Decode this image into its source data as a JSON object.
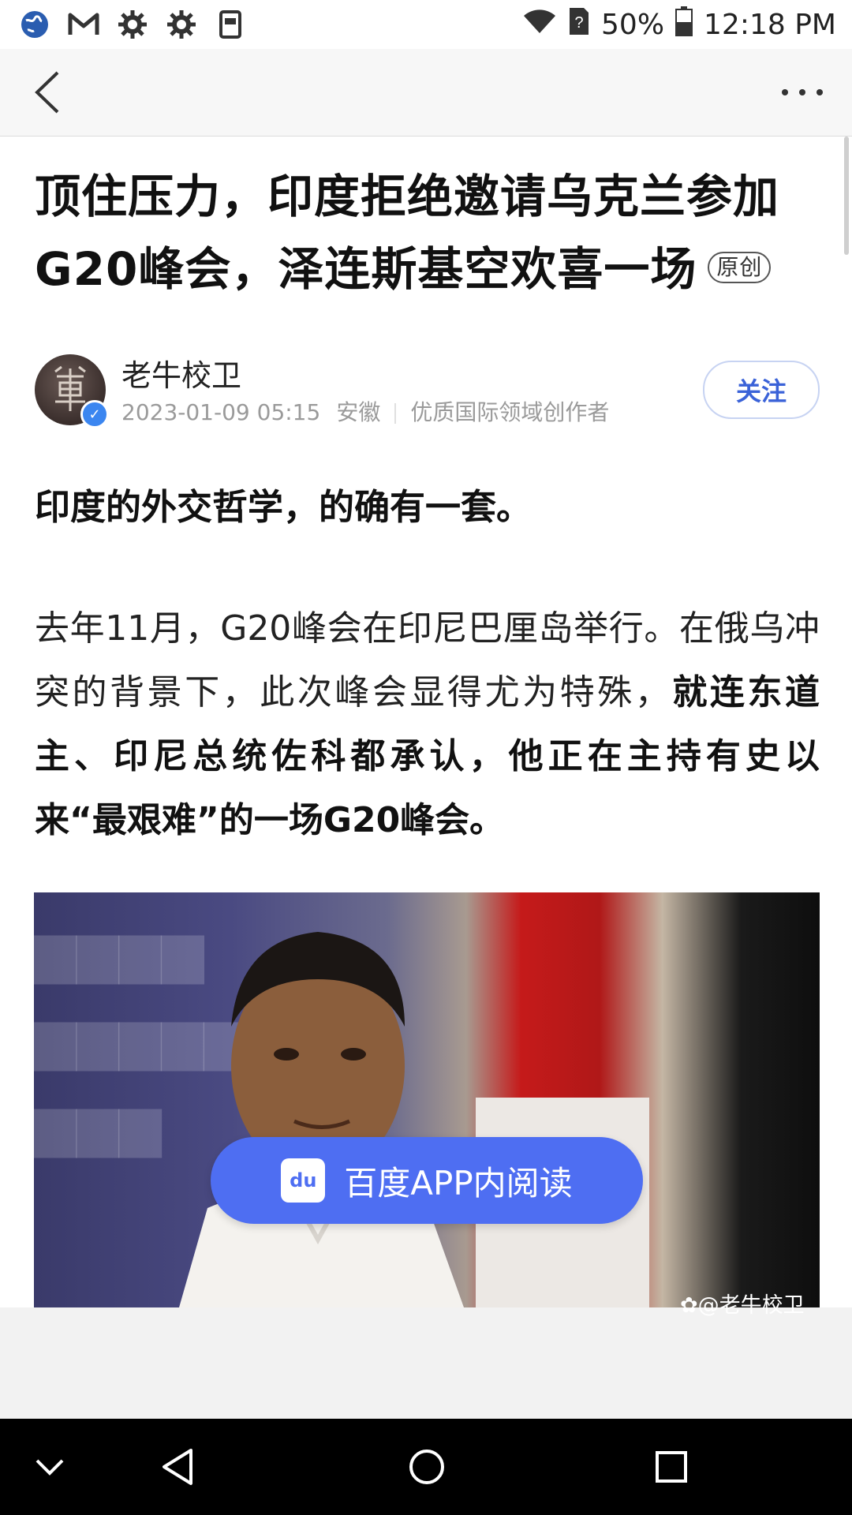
{
  "status_bar": {
    "battery": "50%",
    "time": "12:18 PM",
    "icons": [
      "globe-icon",
      "gmail-icon",
      "gear-icon",
      "gear-icon",
      "reader-icon"
    ],
    "right_icons": [
      "wifi-icon",
      "unknown-sim-icon",
      "battery-icon"
    ]
  },
  "header": {
    "back_icon": "chevron-left-icon",
    "more_icon": "more-dots-icon"
  },
  "article": {
    "title": "顶住压力，印度拒绝邀请乌克兰参加G20峰会，泽连斯基空欢喜一场",
    "original_badge": "原创",
    "author": {
      "name": "老牛校卫",
      "date": "2023-01-09 05:15",
      "region": "安徽",
      "tag": "优质国际领域创作者",
      "follow_label": "关注"
    },
    "lead": "印度的外交哲学，的确有一套。",
    "para_normal": "去年11月，G20峰会在印尼巴厘岛举行。在俄乌冲突的背景下，此次峰会显得尤为特殊，",
    "para_bold": "就连东道主、印尼总统佐科都承认，他正在主持有史以来“最艰难”的一场G20峰会。",
    "image_watermark": "@老牛校卫"
  },
  "open_in_app": {
    "label": "百度APP内阅读",
    "logo_text": "du"
  },
  "colors": {
    "accent": "#4e6ef2",
    "follow_text": "#3a62d8"
  }
}
